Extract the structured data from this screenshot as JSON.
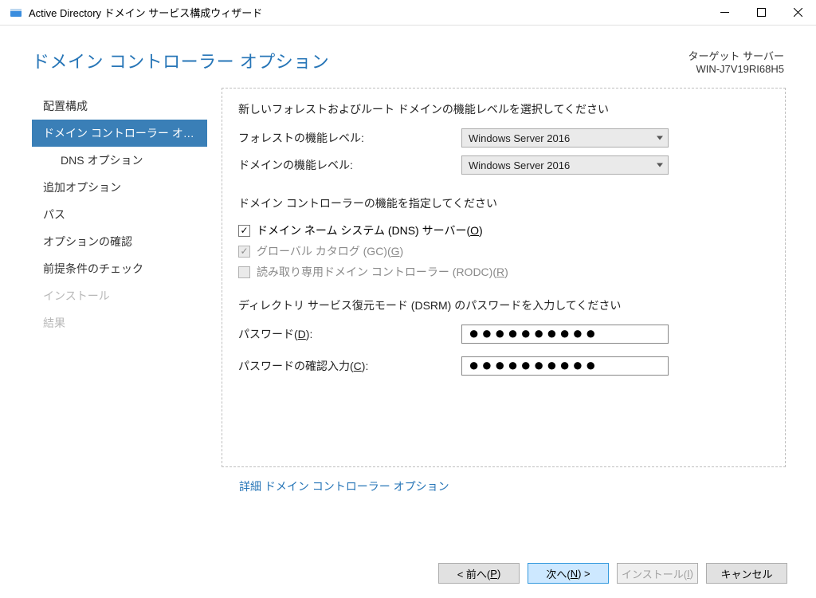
{
  "window": {
    "title": "Active Directory ドメイン サービス構成ウィザード"
  },
  "header": {
    "title": "ドメイン コントローラー オプション",
    "target_label": "ターゲット サーバー",
    "target_value": "WIN-J7V19RI68H5"
  },
  "sidebar": {
    "items": [
      {
        "label": "配置構成",
        "active": false
      },
      {
        "label": "ドメイン コントローラー オプシ...",
        "active": true
      },
      {
        "label": "DNS オプション",
        "indent": true
      },
      {
        "label": "追加オプション"
      },
      {
        "label": "パス"
      },
      {
        "label": "オプションの確認"
      },
      {
        "label": "前提条件のチェック"
      },
      {
        "label": "インストール",
        "disabled": true
      },
      {
        "label": "結果",
        "disabled": true
      }
    ]
  },
  "main": {
    "section1": "新しいフォレストおよびルート ドメインの機能レベルを選択してください",
    "forest_label": "フォレストの機能レベル:",
    "forest_value": "Windows Server 2016",
    "domain_label": "ドメインの機能レベル:",
    "domain_value": "Windows Server 2016",
    "section2": "ドメイン コントローラーの機能を指定してください",
    "chk_dns": "ドメイン ネーム システム (DNS) サーバー(",
    "chk_dns_key": "O",
    "chk_gc": "グローバル カタログ (GC)(",
    "chk_gc_key": "G",
    "chk_rodc": "読み取り専用ドメイン コントローラー (RODC)(",
    "chk_rodc_key": "R",
    "section3": "ディレクトリ サービス復元モード (DSRM) のパスワードを入力してください",
    "pw_label_pre": "パスワード(",
    "pw_key": "D",
    "pw_label_post": "):",
    "pw_value": "●●●●●●●●●●",
    "pwc_label_pre": "パスワードの確認入力(",
    "pwc_key": "C",
    "pwc_label_post": "):",
    "pwc_value": "●●●●●●●●●●",
    "more_link": "詳細 ドメイン コントローラー オプション"
  },
  "footer": {
    "prev_pre": "< 前へ(",
    "prev_key": "P",
    "prev_post": ")",
    "next_pre": "次へ(",
    "next_key": "N",
    "next_post": ") >",
    "install_pre": "インストール(",
    "install_key": "I",
    "install_post": ")",
    "cancel": "キャンセル"
  }
}
